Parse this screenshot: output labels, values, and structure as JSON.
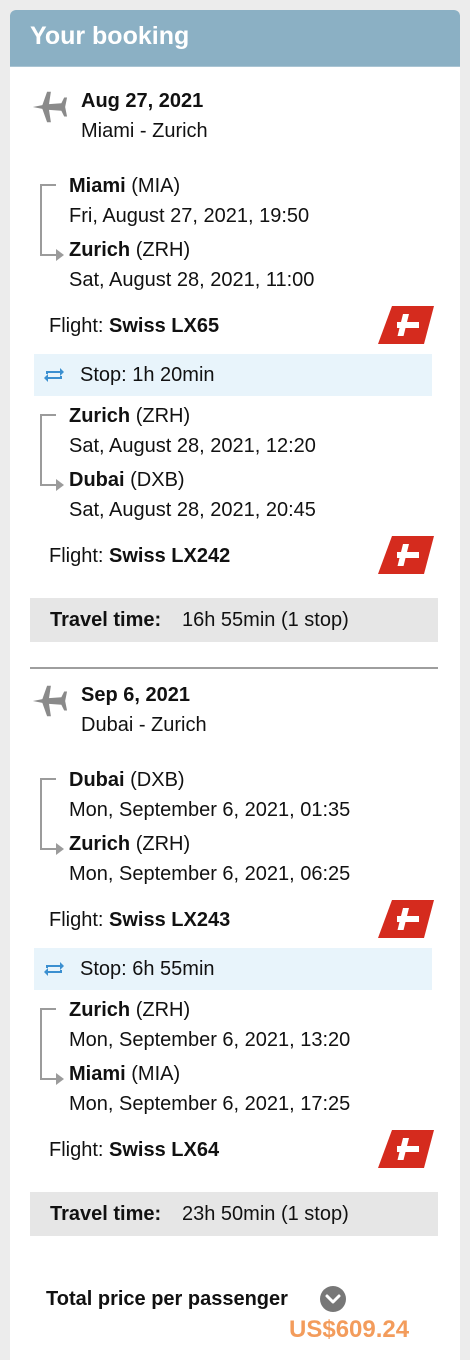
{
  "header": {
    "title": "Your booking"
  },
  "outbound": {
    "date": "Aug 27, 2021",
    "route": "Miami - Zurich",
    "segments": [
      {
        "dep_city": "Miami",
        "dep_code": "(MIA)",
        "dep_time": "Fri, August 27, 2021, 19:50",
        "arr_city": "Zurich",
        "arr_code": "(ZRH)",
        "arr_time": "Sat, August 28, 2021, 11:00",
        "flight_label": "Flight:",
        "flight_no": "Swiss LX65"
      },
      {
        "dep_city": "Zurich",
        "dep_code": "(ZRH)",
        "dep_time": "Sat, August 28, 2021, 12:20",
        "arr_city": "Dubai",
        "arr_code": "(DXB)",
        "arr_time": "Sat, August 28, 2021, 20:45",
        "flight_label": "Flight:",
        "flight_no": "Swiss LX242"
      }
    ],
    "stop": "Stop: 1h 20min",
    "travel_label": "Travel time:",
    "travel_value": "16h 55min (1 stop)"
  },
  "return": {
    "date": "Sep 6, 2021",
    "route": "Dubai - Zurich",
    "segments": [
      {
        "dep_city": "Dubai",
        "dep_code": "(DXB)",
        "dep_time": "Mon, September 6, 2021, 01:35",
        "arr_city": "Zurich",
        "arr_code": "(ZRH)",
        "arr_time": "Mon, September 6, 2021, 06:25",
        "flight_label": "Flight:",
        "flight_no": "Swiss LX243"
      },
      {
        "dep_city": "Zurich",
        "dep_code": "(ZRH)",
        "dep_time": "Mon, September 6, 2021, 13:20",
        "arr_city": "Miami",
        "arr_code": "(MIA)",
        "arr_time": "Mon, September 6, 2021, 17:25",
        "flight_label": "Flight:",
        "flight_no": "Swiss LX64"
      }
    ],
    "stop": "Stop: 6h 55min",
    "travel_label": "Travel time:",
    "travel_value": "23h 50min (1 stop)"
  },
  "total": {
    "label": "Total price per passenger",
    "price": "US$609.24"
  },
  "icons": {
    "plane": "plane-icon",
    "airline": "swiss-airline-logo",
    "stop": "refresh-icon",
    "expand": "chevron-down-icon"
  },
  "colors": {
    "header": "#8bb0c4",
    "price": "#f39c5c",
    "swiss_red": "#d52b1e",
    "stop_bg": "#e8f4fb"
  }
}
